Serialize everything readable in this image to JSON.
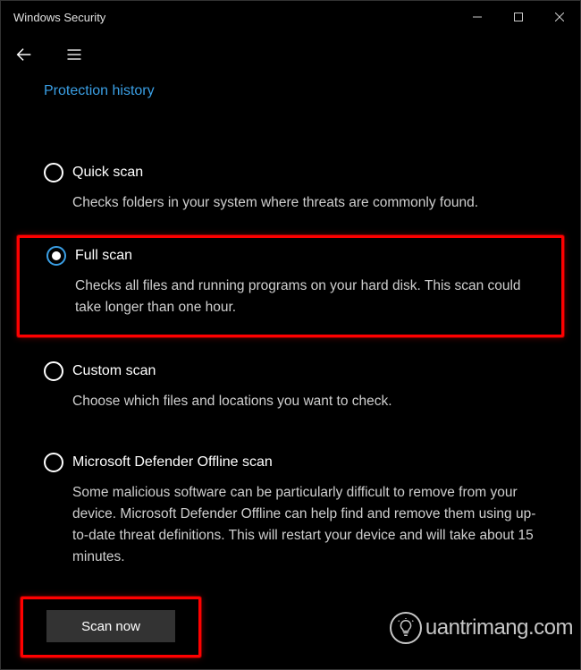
{
  "window": {
    "title": "Windows Security"
  },
  "link": {
    "protection_history": "Protection history"
  },
  "options": [
    {
      "title": "Quick scan",
      "desc": "Checks folders in your system where threats are commonly found.",
      "selected": false,
      "highlighted": false
    },
    {
      "title": "Full scan",
      "desc": "Checks all files and running programs on your hard disk. This scan could take longer than one hour.",
      "selected": true,
      "highlighted": true
    },
    {
      "title": "Custom scan",
      "desc": "Choose which files and locations you want to check.",
      "selected": false,
      "highlighted": false
    },
    {
      "title": "Microsoft Defender Offline scan",
      "desc": "Some malicious software can be particularly difficult to remove from your device. Microsoft Defender Offline can help find and remove them using up-to-date threat definitions. This will restart your device and will take about 15 minutes.",
      "selected": false,
      "highlighted": false
    }
  ],
  "button": {
    "scan_now": "Scan now"
  },
  "watermark": {
    "text": "uantrimang.com"
  }
}
